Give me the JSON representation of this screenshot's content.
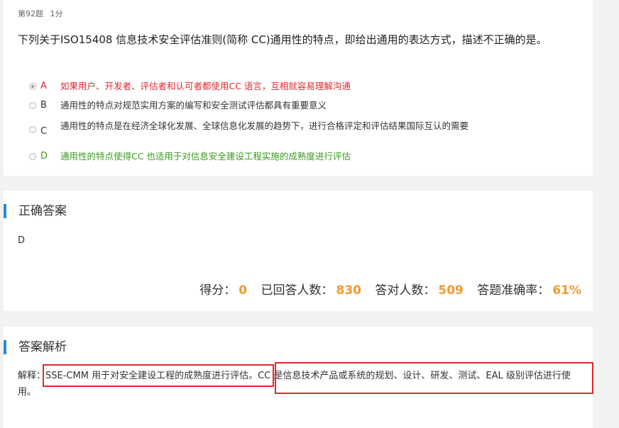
{
  "question": {
    "number_label": "第92题",
    "score_label": "1分",
    "stem": "下列关于ISO15408 信息技术安全评估准则(简称 CC)通用性的特点，即给出通用的表达方式，描述不正确的是。",
    "options": [
      {
        "letter": "A",
        "text": "如果用户、开发者、评估者和认可者都使用CC 语言，互相就容易理解沟通"
      },
      {
        "letter": "B",
        "text": "通用性的特点对规范实用方案的编写和安全测试评估都具有重要意义"
      },
      {
        "letter": "C",
        "text": "通用性的特点是在经济全球化发展、全球信息化发展的趋势下，进行合格评定和评估结果国际互认的需要"
      },
      {
        "letter": "D",
        "text": "通用性的特点使得CC 也适用于对信息安全建设工程实施的成熟度进行评估"
      }
    ],
    "selected": "A",
    "colors": {
      "wrong": "#e0292e",
      "correct": "#3a9a1e"
    }
  },
  "answer": {
    "title": "正确答案",
    "value": "D",
    "stats": {
      "score_label": "得分：",
      "score": "0",
      "answered_label": "已回答人数：",
      "answered": "830",
      "correct_label": "答对人数：",
      "correct": "509",
      "accuracy_label": "答题准确率：",
      "accuracy": "61%"
    }
  },
  "analysis": {
    "title": "答案解析",
    "prefix": "解释：",
    "part1": "SSE-CMM 用于对安全建设工程的成熟度进行评估。",
    "part2": "CC 是信息技术产品或系统的规划、设计、研发、测试、EAL 级别评估进行使用。"
  },
  "colors": {
    "accent": "#2b8ad8",
    "stat_number": "#f39a2d",
    "highlight": "#e0292e"
  }
}
